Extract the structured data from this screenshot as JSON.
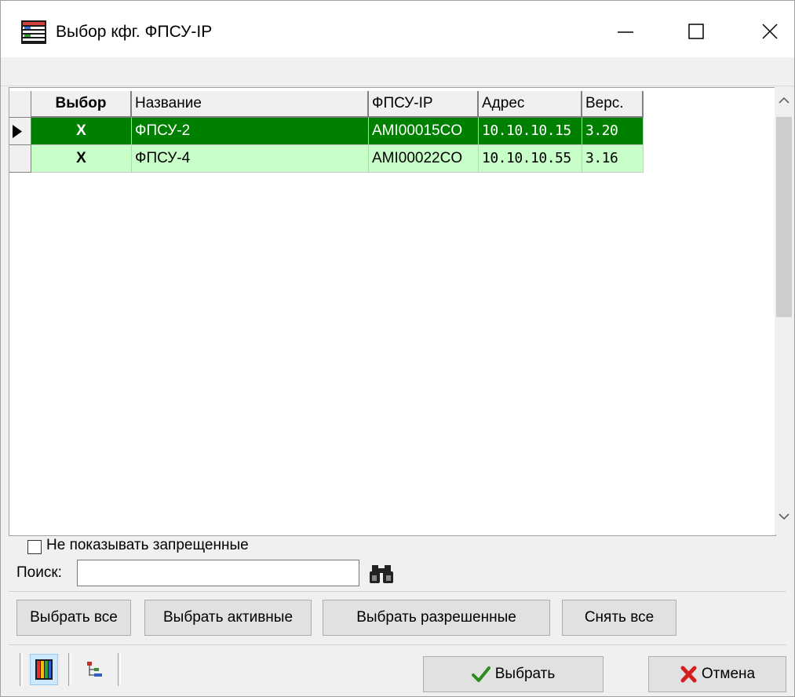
{
  "window": {
    "title": "Выбор кфг. ФПСУ-IP",
    "minimize_symbol": "—",
    "maximize_symbol": "☐",
    "close_symbol": "✕"
  },
  "grid": {
    "columns": [
      "Выбор",
      "Название",
      "ФПСУ-IP",
      "Адрес",
      "Верс."
    ],
    "rows": [
      {
        "select": "X",
        "name": "ФПСУ-2",
        "id": "AMI00015CO",
        "address": "10.10.10.15",
        "version": "3.20",
        "selected": true
      },
      {
        "select": "X",
        "name": "ФПСУ-4",
        "id": "AMI00022CO",
        "address": "10.10.10.55",
        "version": "3.16",
        "selected": false
      }
    ]
  },
  "filter": {
    "hide_forbidden_label": "Не показывать запрещенные",
    "hide_forbidden_checked": false,
    "search_label": "Поиск:",
    "search_value": ""
  },
  "buttons": {
    "select_all": "Выбрать все",
    "select_active": "Выбрать активные",
    "select_allowed": "Выбрать разрешенные",
    "clear_all": "Снять все",
    "ok": "Выбрать",
    "cancel": "Отмена"
  },
  "icons": {
    "title": "grid-icon",
    "search": "binoculars-icon",
    "view_grid": "color-grid-icon",
    "view_tree": "tree-icon",
    "ok": "checkmark-icon",
    "cancel": "red-x-icon"
  },
  "colors": {
    "selected_row": "#008000",
    "row": "#c8ffc8",
    "ok_check": "#2e8b1f",
    "cancel_x": "#d22020"
  }
}
